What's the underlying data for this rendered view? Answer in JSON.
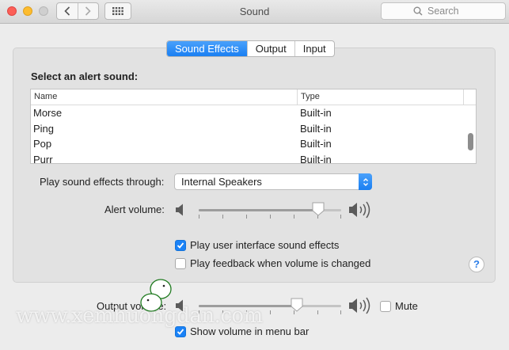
{
  "window": {
    "title": "Sound",
    "search_placeholder": "Search"
  },
  "tabs": [
    {
      "label": "Sound Effects",
      "active": true
    },
    {
      "label": "Output",
      "active": false
    },
    {
      "label": "Input",
      "active": false
    }
  ],
  "alert": {
    "section_label": "Select an alert sound:",
    "columns": [
      "Name",
      "Type"
    ],
    "rows": [
      {
        "name": "Morse",
        "type": "Built-in"
      },
      {
        "name": "Ping",
        "type": "Built-in"
      },
      {
        "name": "Pop",
        "type": "Built-in"
      },
      {
        "name": "Purr",
        "type": "Built-in"
      }
    ]
  },
  "play_through": {
    "label": "Play sound effects through:",
    "selected": "Internal Speakers"
  },
  "alert_volume": {
    "label": "Alert volume:",
    "level": 0.84
  },
  "options": {
    "ui_sounds": {
      "label": "Play user interface sound effects",
      "checked": true
    },
    "feedback": {
      "label": "Play feedback when volume is changed",
      "checked": false
    }
  },
  "output_volume": {
    "label": "Output volume:",
    "level": 0.69,
    "mute_label": "Mute",
    "muted": false
  },
  "menu_bar": {
    "label": "Show volume in menu bar",
    "checked": true
  },
  "help_label": "?",
  "watermark": "www.xemhuongdan.com",
  "colors": {
    "accent": "#1a82f7",
    "close": "#fc5f57",
    "minimize": "#fdbc2e"
  }
}
